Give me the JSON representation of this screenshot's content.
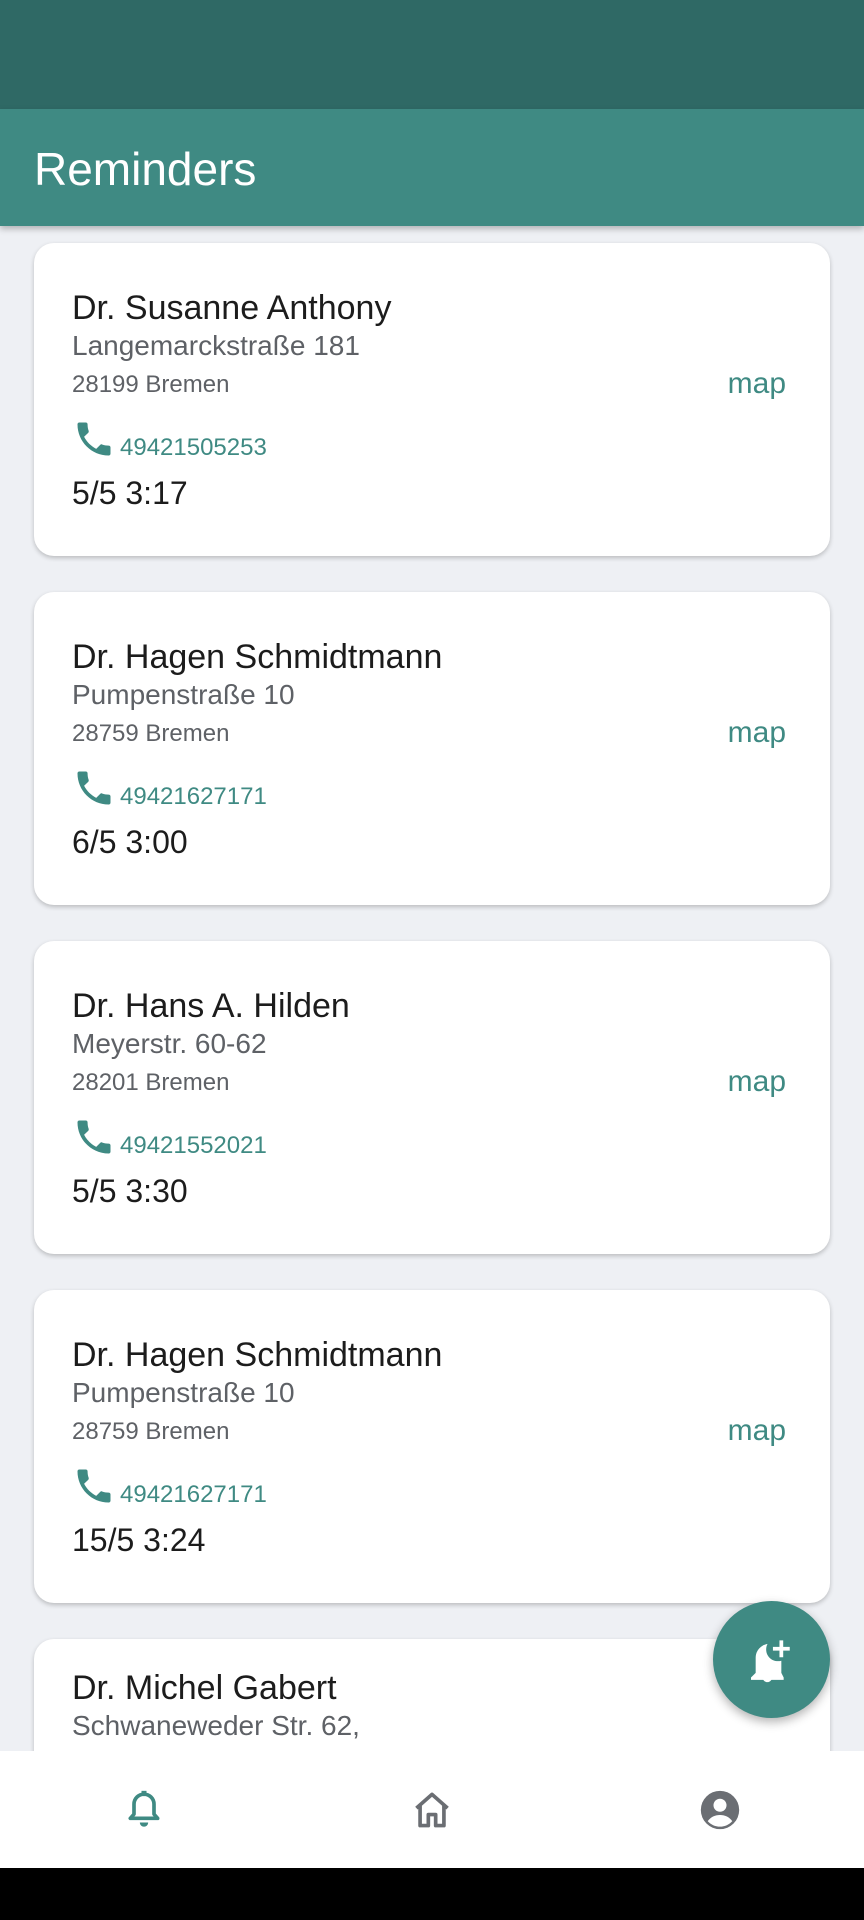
{
  "app_bar": {
    "title": "Reminders"
  },
  "reminders": [
    {
      "name": "Dr. Susanne Anthony",
      "street": "Langemarckstraße 181",
      "city": "28199 Bremen",
      "phone": "49421505253",
      "datetime": "5/5 3:17",
      "map_label": "map"
    },
    {
      "name": "Dr. Hagen Schmidtmann",
      "street": "Pumpenstraße 10",
      "city": "28759 Bremen",
      "phone": "49421627171",
      "datetime": "6/5 3:00",
      "map_label": "map"
    },
    {
      "name": "Dr. Hans A. Hilden",
      "street": "Meyerstr. 60-62",
      "city": "28201 Bremen",
      "phone": "49421552021",
      "datetime": "5/5 3:30",
      "map_label": "map"
    },
    {
      "name": "Dr. Hagen Schmidtmann",
      "street": "Pumpenstraße 10",
      "city": "28759 Bremen",
      "phone": "49421627171",
      "datetime": "15/5 3:24",
      "map_label": "map"
    },
    {
      "name": "Dr. Michel Gabert",
      "street": "Schwaneweder Str. 62,",
      "city": "",
      "phone": "",
      "datetime": "",
      "map_label": ""
    }
  ],
  "icons": {
    "phone": "phone-icon",
    "fab": "add-alert-icon",
    "nav_reminders": "bell-icon",
    "nav_home": "home-icon",
    "nav_profile": "account-circle-icon"
  },
  "colors": {
    "status_bar": "#2f6965",
    "app_bar": "#3f8a83",
    "accent": "#3f8a83",
    "background": "#eef0f4",
    "nav_inactive": "#6b6e73"
  },
  "bottom_nav": {
    "active": "reminders"
  }
}
